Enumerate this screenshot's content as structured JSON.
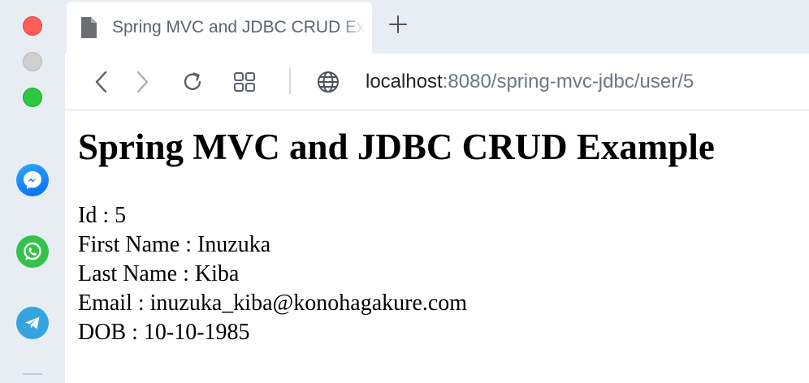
{
  "browser": {
    "tab": {
      "title": "Spring MVC and JDBC CRUD Example",
      "icon": "file-icon"
    },
    "new_tab_icon": "plus-icon",
    "toolbar": {
      "back_icon": "chevron-left-icon",
      "forward_icon": "chevron-right-icon",
      "reload_icon": "reload-icon",
      "tabs_overview_icon": "grid-icon",
      "site_icon": "globe-icon",
      "url_host": "localhost",
      "url_rest": ":8080/spring-mvc-jdbc/user/5"
    }
  },
  "sidebar": {
    "apps": [
      "messenger-icon",
      "whatsapp-icon",
      "telegram-icon"
    ]
  },
  "page": {
    "heading": "Spring MVC and JDBC CRUD Example",
    "fields": {
      "id": "Id : 5",
      "first_name": "First Name : Inuzuka",
      "last_name": "Last Name : Kiba",
      "email": "Email : inuzuka_kiba@konohagakure.com",
      "dob": "DOB : 10-10-1985"
    }
  },
  "colors": {
    "chrome_bg": "#e8edf4",
    "close": "#fe5f57",
    "minimize": "#cfcfcf",
    "maximize": "#2bc840",
    "url_host": "#1e2226",
    "url_rest": "#6b7785"
  }
}
